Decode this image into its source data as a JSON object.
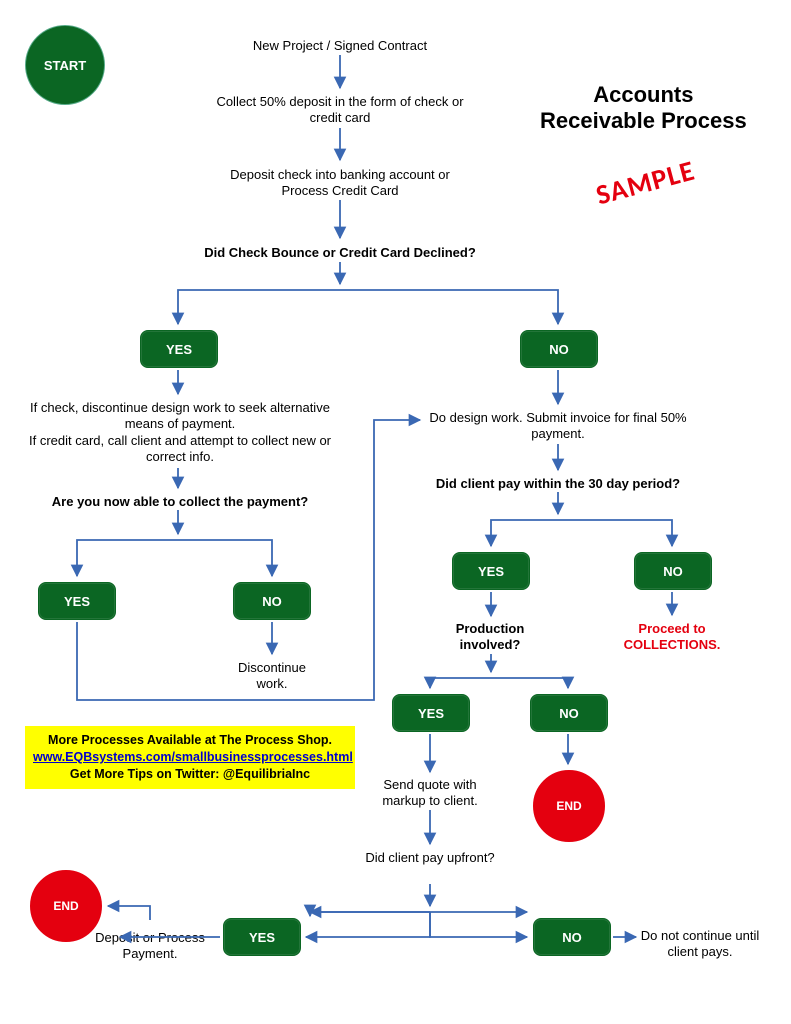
{
  "title": "Accounts Receivable Process",
  "stamp": "SAMPLE",
  "start": "START",
  "end": "END",
  "steps": {
    "s1": "New Project / Signed Contract",
    "s2": "Collect 50% deposit in the form of check or credit card",
    "s3": "Deposit check into banking account or Process Credit Card",
    "q1": "Did Check Bounce or Credit Card Declined?",
    "s4": "If check, discontinue design work to seek alternative means of payment.\nIf credit card, call client and attempt to collect new or correct info.",
    "q2": "Are you now able to collect the payment?",
    "s5": "Discontinue work.",
    "s6": "Do design work.  Submit invoice for final 50% payment.",
    "q3": "Did client pay within the 30 day period?",
    "s7": "Proceed to COLLECTIONS.",
    "q4": "Production involved?",
    "s8": "Send quote with markup to client.",
    "q5": "Did client pay upfront?",
    "s9": "Deposit or Process Payment.",
    "s10": "Do not continue until client pays."
  },
  "labels": {
    "yes": "YES",
    "no": "NO"
  },
  "promo": {
    "line1": "More Processes Available at The Process Shop.",
    "link": "www.EQBsystems.com/smallbusinessprocesses.html",
    "line3": "Get More Tips on Twitter: @EquilibriaInc"
  }
}
